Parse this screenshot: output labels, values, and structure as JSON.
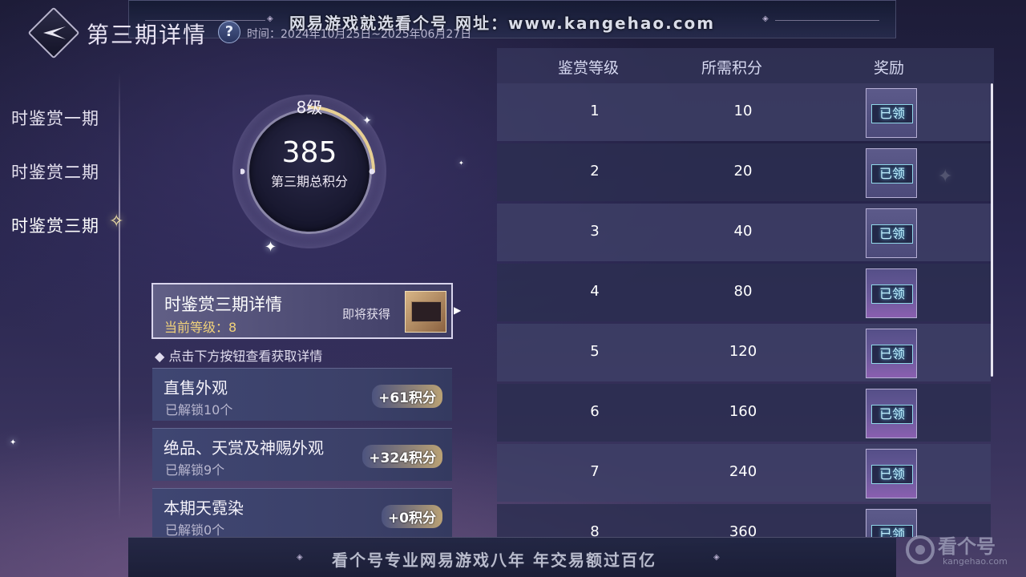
{
  "header": {
    "title": "第三期详情",
    "time_text": "时间：2024年10月25日~2025年06月27日"
  },
  "watermark_top": "网易游戏就选看个号   网址：www.kangehao.com",
  "watermark_bottom": "看个号专业网易游戏八年   年交易额过百亿",
  "brand": {
    "name": "看个号",
    "url": "kangehao.com"
  },
  "sidebar": {
    "items": [
      {
        "label": "时鉴赏一期"
      },
      {
        "label": "时鉴赏二期"
      },
      {
        "label": "时鉴赏三期",
        "active": true
      }
    ]
  },
  "score_circle": {
    "level": "8级",
    "points": "385",
    "label": "第三期总积分",
    "arc_progress": 0.25
  },
  "detail_card": {
    "title": "时鉴赏三期详情",
    "current_level": "当前等级：8",
    "coming_soon": "即将获得"
  },
  "hint": "◆ 点击下方按钮查看获取详情",
  "categories": [
    {
      "name": "直售外观",
      "sub": "已解锁10个",
      "points": "+61积分"
    },
    {
      "name": "绝品、天赏及神赐外观",
      "sub": "已解锁9个",
      "points": "+324积分"
    },
    {
      "name": "本期天霓染",
      "sub": "已解锁0个",
      "points": "+0积分"
    }
  ],
  "table": {
    "headers": {
      "level": "鉴赏等级",
      "points": "所需积分",
      "reward": "奖励"
    },
    "rows": [
      {
        "level": "1",
        "points": "10",
        "reward": "已领"
      },
      {
        "level": "2",
        "points": "20",
        "reward": "已领"
      },
      {
        "level": "3",
        "points": "40",
        "reward": "已领"
      },
      {
        "level": "4",
        "points": "80",
        "reward": "已领"
      },
      {
        "level": "5",
        "points": "120",
        "reward": "已领"
      },
      {
        "level": "6",
        "points": "160",
        "reward": "已领"
      },
      {
        "level": "7",
        "points": "240",
        "reward": "已领"
      },
      {
        "level": "8",
        "points": "360",
        "reward": "已领"
      }
    ]
  },
  "colors": {
    "accent_gold": "#f1d27a",
    "claimed_cyan": "#bff0ff",
    "panel": "#3e4068"
  }
}
